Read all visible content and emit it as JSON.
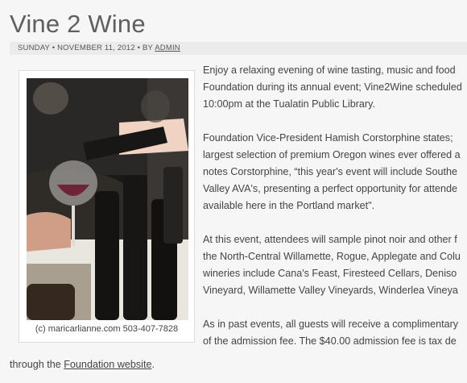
{
  "post": {
    "title": "Vine 2 Wine",
    "meta": {
      "date": "SUNDAY • NOVEMBER 11, 2012 • BY",
      "author": "ADMIN"
    }
  },
  "figure": {
    "image_alt": "wine-pour-photo",
    "caption": "(c) maricarlianne.com 503-407-7828"
  },
  "paragraphs": [
    [
      "Enjoy a relaxing evening of wine tasting, music and food",
      "Foundation during its annual event; Vine2Wine scheduled",
      "10:00pm at the Tualatin Public Library."
    ],
    [
      "Foundation Vice-President Hamish Corstorphine states;",
      "largest selection of premium Oregon wines ever offered a",
      "notes Corstorphine, “this year's event will include Southe",
      "Valley AVA's, presenting a perfect opportunity for attende",
      "available here in the Portland market\"."
    ],
    [
      "At this event, attendees will sample pinot noir and other f",
      "the North-Central Willamette, Rogue, Applegate and Colu",
      "wineries include Cana's Feast, Firesteed Cellars, Deniso",
      "Vineyard, Willamette Valley Vineyards, Winderlea Vineya"
    ],
    [
      "As in past events, all guests will receive a complimentary",
      "of the admission fee. The $40.00 admission fee is tax de"
    ]
  ],
  "tail": {
    "prefix": "through the",
    "link": "Foundation website",
    "suffix": "."
  },
  "colors": {
    "background": "#f6f6f6",
    "meta_bar": "#ebebeb",
    "text": "#444444"
  }
}
